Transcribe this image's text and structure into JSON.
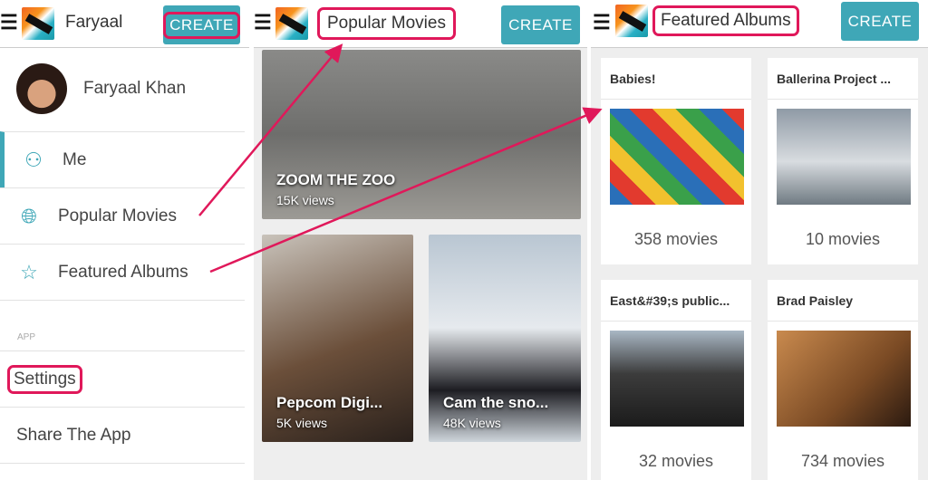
{
  "left_panel": {
    "title": "Faryaal",
    "create_label": "CREATE",
    "user_name": "Faryaal Khan",
    "menu": [
      {
        "label": "Me",
        "icon": "person-icon"
      },
      {
        "label": "Popular Movies",
        "icon": "globe-icon"
      },
      {
        "label": "Featured Albums",
        "icon": "star-icon"
      }
    ],
    "section_label": "APP",
    "settings_label": "Settings",
    "share_label": "Share The App"
  },
  "middle_panel": {
    "title": "Popular Movies",
    "create_label": "CREATE",
    "movies": [
      {
        "title": "ZOOM THE ZOO",
        "views": "15K views"
      },
      {
        "title": "Pepcom Digi...",
        "views": "5K views"
      },
      {
        "title": "Cam the sno...",
        "views": "48K views"
      }
    ]
  },
  "right_panel": {
    "title": "Featured Albums",
    "create_label": "CREATE",
    "albums": [
      {
        "title": "Babies!",
        "count": "358 movies"
      },
      {
        "title": "Ballerina Project ...",
        "count": "10 movies"
      },
      {
        "title": "East&#39;s public...",
        "count": "32 movies"
      },
      {
        "title": "Brad Paisley",
        "count": "734 movies"
      }
    ]
  },
  "colors": {
    "accent": "#3fa7b7",
    "highlight": "#e0185a"
  }
}
